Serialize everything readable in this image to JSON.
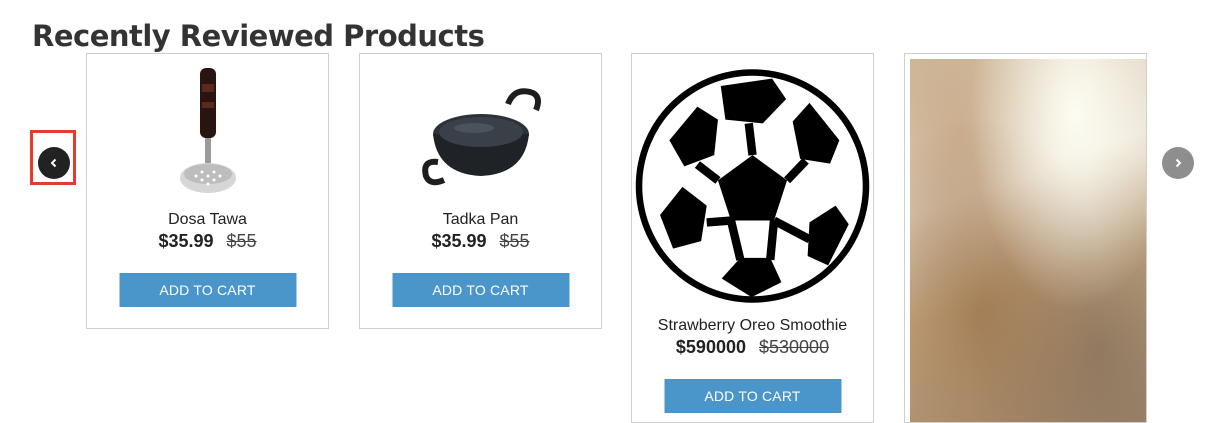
{
  "section": {
    "title": "Recently Reviewed Products"
  },
  "carousel": {
    "prev_icon": "chevron-left-icon",
    "next_icon": "chevron-right-icon",
    "highlight_color": "#e6392f"
  },
  "products": [
    {
      "name": "Dosa Tawa",
      "price": "$35.99",
      "old_price": "$55",
      "button": "ADD TO CART",
      "image": "potato-masher-image"
    },
    {
      "name": "Tadka Pan",
      "price": "$35.99",
      "old_price": "$55",
      "button": "ADD TO CART",
      "image": "kadai-pan-image"
    },
    {
      "name": "Strawberry Oreo Smoothie",
      "price": "$590000",
      "old_price": "$530000",
      "button": "ADD TO CART",
      "image": "soccer-ball-image"
    },
    {
      "name": "",
      "image": "marble-texture-image"
    }
  ],
  "colors": {
    "button": "#4a95c9",
    "prev_arrow": "#222222",
    "next_arrow": "#8e8e8e"
  }
}
